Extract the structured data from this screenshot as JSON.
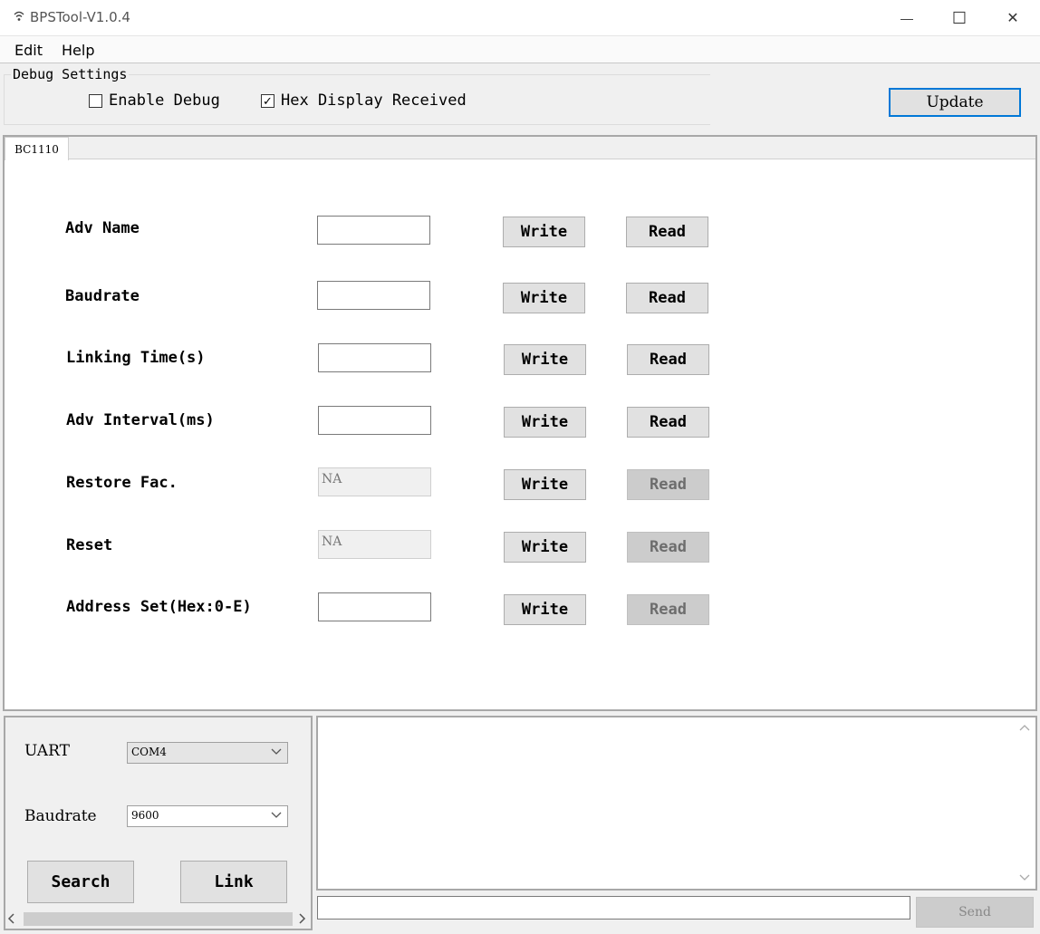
{
  "window": {
    "title": "BPSTool-V1.0.4",
    "minimize_glyph": "—",
    "maximize_glyph": "☐",
    "close_glyph": "✕"
  },
  "menu": {
    "edit": "Edit",
    "help": "Help"
  },
  "debug": {
    "legend": "Debug Settings",
    "enable_debug": {
      "label": "Enable Debug",
      "checked": false,
      "mark": ""
    },
    "hex_display": {
      "label": "Hex Display Received",
      "checked": true,
      "mark": "✓"
    },
    "update_label": "Update"
  },
  "tabs": [
    {
      "label": "BC1110",
      "selected": true
    }
  ],
  "rows": [
    {
      "label": "Adv Name",
      "value": "",
      "write": "Write",
      "read": "Read",
      "read_enabled": true
    },
    {
      "label": "Baudrate",
      "value": "",
      "write": "Write",
      "read": "Read",
      "read_enabled": true
    },
    {
      "label": "Linking Time(s)",
      "value": "",
      "write": "Write",
      "read": "Read",
      "read_enabled": true
    },
    {
      "label": "Adv Interval(ms)",
      "value": "",
      "write": "Write",
      "read": "Read",
      "read_enabled": true
    },
    {
      "label": "Restore Fac.",
      "value": "NA",
      "write": "Write",
      "read": "Read",
      "read_enabled": false
    },
    {
      "label": "Reset",
      "value": "NA",
      "write": "Write",
      "read": "Read",
      "read_enabled": false
    },
    {
      "label": "Address Set(Hex:0-E)",
      "value": "",
      "write": "Write",
      "read": "Read",
      "read_enabled": false
    }
  ],
  "connection": {
    "uart_label": "UART",
    "uart_value": "COM4",
    "baud_label": "Baudrate",
    "baud_value": "9600",
    "search_label": "Search",
    "link_label": "Link"
  },
  "log": {
    "text": "",
    "send_value": "",
    "send_label": "Send"
  },
  "colors": {
    "accent": "#0078d7",
    "button": "#e1e1e1",
    "disabled_button": "#cccccc"
  }
}
